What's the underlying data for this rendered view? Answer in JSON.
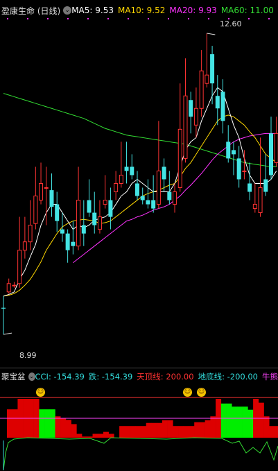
{
  "kline_header": {
    "stock_name": "盈康生命 (日线)",
    "indicators": [
      {
        "label": "MA5: 9.53",
        "color": "#ffffff"
      },
      {
        "label": "MA10: 9.52",
        "color": "#ffd700"
      },
      {
        "label": "MA20: 9.93",
        "color": "#ff33ff"
      },
      {
        "label": "MA60: 11.00",
        "color": "#33dd33"
      }
    ]
  },
  "price_annotations": {
    "high": "12.60",
    "low": "8.99"
  },
  "sub_header": {
    "name": "聚宝盆",
    "items": [
      {
        "label": "CCI: -154.39",
        "color": "#33dddd"
      },
      {
        "label": "跌: -154.39",
        "color": "#33dddd"
      },
      {
        "label": "天顶线: 200.00",
        "color": "#ff3333"
      },
      {
        "label": "地底线: -200.00",
        "color": "#33dddd"
      },
      {
        "label": "牛熊",
        "color": "#ff44ff"
      }
    ]
  },
  "colors": {
    "up": "#ff3333",
    "down": "#44e4e4",
    "ma5": "#ffffff",
    "ma10": "#ffd700",
    "ma20": "#ff33ff",
    "ma60": "#33dd33",
    "bar_red": "#dd0000",
    "bar_green": "#00ee00",
    "face": "#f2c200"
  },
  "chart_data": {
    "type": "candlestick",
    "price_range": [
      8.8,
      12.75
    ],
    "candles": [
      [
        9.31,
        9.3,
        9.45,
        8.99
      ],
      [
        9.5,
        9.6,
        9.66,
        9.48
      ],
      [
        9.58,
        9.58,
        9.62,
        9.55
      ],
      [
        9.6,
        10.0,
        10.4,
        9.55
      ],
      [
        10.0,
        10.1,
        10.4,
        9.9
      ],
      [
        10.1,
        10.3,
        10.6,
        10.0
      ],
      [
        10.32,
        10.65,
        11.0,
        10.25
      ],
      [
        10.6,
        10.8,
        11.05,
        10.55
      ],
      [
        10.75,
        10.75,
        11.0,
        10.3
      ],
      [
        10.72,
        10.52,
        10.92,
        10.4
      ],
      [
        10.55,
        10.35,
        10.7,
        10.22
      ],
      [
        10.25,
        10.2,
        10.45,
        10.1
      ],
      [
        10.2,
        10.0,
        10.25,
        9.85
      ],
      [
        10.1,
        10.05,
        10.35,
        9.95
      ],
      [
        10.05,
        10.6,
        11.0,
        10.0
      ],
      [
        10.3,
        10.2,
        10.6,
        10.05
      ],
      [
        10.6,
        10.45,
        10.85,
        10.4
      ],
      [
        10.45,
        10.3,
        10.7,
        10.2
      ],
      [
        10.25,
        10.4,
        10.6,
        10.2
      ],
      [
        10.55,
        10.6,
        10.9,
        10.5
      ],
      [
        10.6,
        10.4,
        10.75,
        10.25
      ],
      [
        10.7,
        10.8,
        10.95,
        10.6
      ],
      [
        10.8,
        10.9,
        11.3,
        10.75
      ],
      [
        11.0,
        10.95,
        11.3,
        10.8
      ],
      [
        11.0,
        10.9,
        11.15,
        10.85
      ],
      [
        10.8,
        10.65,
        10.95,
        10.6
      ],
      [
        10.65,
        10.6,
        10.75,
        10.55
      ],
      [
        10.6,
        10.55,
        10.85,
        10.5
      ],
      [
        10.6,
        10.5,
        10.9,
        10.45
      ],
      [
        10.55,
        10.95,
        11.55,
        10.5
      ],
      [
        11.0,
        10.85,
        11.1,
        10.7
      ],
      [
        10.7,
        10.6,
        10.95,
        10.55
      ],
      [
        10.55,
        10.7,
        10.8,
        10.45
      ],
      [
        10.75,
        11.45,
        12.0,
        10.7
      ],
      [
        11.1,
        11.85,
        12.3,
        11.05
      ],
      [
        11.8,
        11.6,
        11.9,
        11.4
      ],
      [
        11.5,
        11.7,
        11.95,
        11.35
      ],
      [
        11.7,
        12.15,
        12.4,
        11.6
      ],
      [
        12.0,
        12.1,
        12.6,
        11.95
      ],
      [
        12.35,
        12.0,
        12.45,
        11.75
      ],
      [
        11.85,
        11.7,
        12.1,
        11.5
      ],
      [
        11.9,
        11.55,
        12.05,
        11.4
      ],
      [
        11.3,
        11.1,
        11.5,
        11.05
      ],
      [
        11.2,
        11.15,
        11.3,
        10.9
      ],
      [
        11.1,
        10.85,
        11.25,
        10.75
      ],
      [
        10.95,
        10.95,
        11.2,
        10.85
      ],
      [
        10.8,
        10.7,
        11.05,
        10.6
      ],
      [
        10.5,
        10.55,
        10.8,
        10.45
      ],
      [
        10.45,
        10.75,
        11.35,
        10.4
      ],
      [
        10.85,
        10.7,
        11.15,
        10.65
      ],
      [
        11.4,
        10.9,
        11.6,
        10.85
      ],
      [
        11.05,
        11.4,
        11.6,
        11.0
      ]
    ],
    "ma5": [
      9.45,
      9.47,
      9.5,
      9.65,
      9.76,
      9.92,
      10.07,
      10.3,
      10.45,
      10.55,
      10.55,
      10.45,
      10.35,
      10.25,
      10.3,
      10.27,
      10.3,
      10.36,
      10.38,
      10.4,
      10.45,
      10.55,
      10.65,
      10.7,
      10.8,
      10.85,
      10.8,
      10.75,
      10.7,
      10.7,
      10.7,
      10.7,
      10.8,
      11.0,
      11.2,
      11.3,
      11.35,
      11.55,
      11.7,
      11.85,
      11.95,
      11.9,
      11.7,
      11.5,
      11.35,
      11.1,
      10.9,
      10.8,
      10.8,
      10.8,
      10.85,
      10.95
    ],
    "ma10": [
      9.45,
      9.46,
      9.48,
      9.52,
      9.58,
      9.65,
      9.75,
      9.86,
      10.0,
      10.1,
      10.2,
      10.28,
      10.32,
      10.35,
      10.36,
      10.37,
      10.36,
      10.35,
      10.32,
      10.33,
      10.35,
      10.4,
      10.45,
      10.5,
      10.55,
      10.6,
      10.65,
      10.68,
      10.7,
      10.72,
      10.75,
      10.78,
      10.8,
      10.88,
      10.98,
      11.05,
      11.15,
      11.25,
      11.35,
      11.45,
      11.55,
      11.6,
      11.62,
      11.6,
      11.55,
      11.5,
      11.42,
      11.35,
      11.25,
      11.15,
      11.1,
      11.05
    ],
    "ma20": [
      null,
      null,
      null,
      null,
      null,
      null,
      null,
      null,
      null,
      null,
      null,
      null,
      null,
      9.85,
      9.9,
      9.95,
      10.0,
      10.05,
      10.1,
      10.15,
      10.2,
      10.25,
      10.3,
      10.35,
      10.37,
      10.4,
      10.42,
      10.45,
      10.48,
      10.5,
      10.52,
      10.55,
      10.6,
      10.65,
      10.72,
      10.78,
      10.85,
      10.92,
      11.0,
      11.08,
      11.15,
      11.2,
      11.25,
      11.3,
      11.33,
      11.35,
      11.37,
      11.38,
      11.39,
      11.4,
      11.4,
      11.4
    ],
    "ma60": [
      11.88,
      11.86,
      11.84,
      11.82,
      11.8,
      11.78,
      11.76,
      11.74,
      11.72,
      11.7,
      11.68,
      11.66,
      11.64,
      11.62,
      11.6,
      11.58,
      11.55,
      11.52,
      11.49,
      11.46,
      11.44,
      11.42,
      11.4,
      11.38,
      11.37,
      11.36,
      11.35,
      11.34,
      11.33,
      11.32,
      11.31,
      11.3,
      11.29,
      11.28,
      11.27,
      11.25,
      11.23,
      11.21,
      11.19,
      11.17,
      11.15,
      11.13,
      11.11,
      11.09,
      11.07,
      11.05,
      11.04,
      11.03,
      11.02,
      11.01,
      11.0,
      11.0
    ],
    "cci_bars": [
      [
        0,
        "red",
        73
      ],
      [
        1,
        "red",
        73
      ],
      [
        2,
        "red",
        100
      ],
      [
        3,
        "red",
        100
      ],
      [
        4,
        "red",
        100
      ],
      [
        5,
        "red",
        100
      ],
      [
        6,
        "green",
        73
      ],
      [
        7,
        "green",
        73
      ],
      [
        8,
        "green",
        73
      ],
      [
        9,
        "red",
        55
      ],
      [
        10,
        "red",
        50
      ],
      [
        11,
        "red",
        46
      ],
      [
        12,
        "red",
        35
      ],
      [
        13,
        "red",
        10
      ],
      [
        14,
        "red",
        3
      ],
      [
        15,
        "red",
        3
      ],
      [
        16,
        "red",
        10
      ],
      [
        17,
        "red",
        10
      ],
      [
        18,
        "red",
        15
      ],
      [
        19,
        "red",
        10
      ],
      [
        20,
        "red",
        0
      ],
      [
        21,
        "red",
        30
      ],
      [
        22,
        "red",
        30
      ],
      [
        23,
        "red",
        30
      ],
      [
        24,
        "red",
        30
      ],
      [
        25,
        "red",
        30
      ],
      [
        26,
        "red",
        38
      ],
      [
        27,
        "red",
        38
      ],
      [
        28,
        "red",
        38
      ],
      [
        29,
        "red",
        45
      ],
      [
        30,
        "red",
        45
      ],
      [
        31,
        "red",
        30
      ],
      [
        32,
        "red",
        30
      ],
      [
        33,
        "red",
        30
      ],
      [
        34,
        "red",
        30
      ],
      [
        35,
        "red",
        40
      ],
      [
        36,
        "red",
        40
      ],
      [
        37,
        "red",
        45
      ],
      [
        38,
        "red",
        55
      ],
      [
        39,
        "red",
        100
      ],
      [
        40,
        "green",
        88
      ],
      [
        41,
        "green",
        88
      ],
      [
        42,
        "green",
        80
      ],
      [
        43,
        "green",
        80
      ],
      [
        44,
        "green",
        80
      ],
      [
        45,
        "green",
        72
      ],
      [
        46,
        "red",
        100
      ],
      [
        47,
        "red",
        90
      ],
      [
        48,
        "red",
        55
      ],
      [
        49,
        "red",
        30
      ],
      [
        50,
        "red",
        30
      ],
      [
        51,
        "red",
        10
      ]
    ]
  }
}
